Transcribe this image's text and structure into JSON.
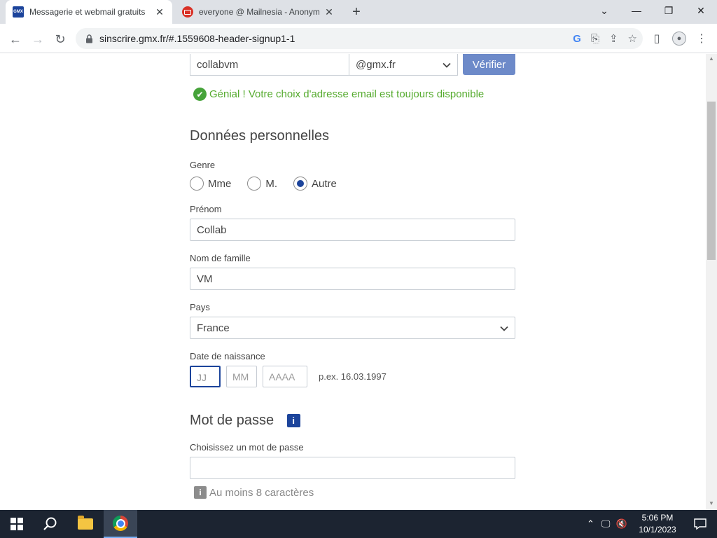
{
  "browser": {
    "tabs": [
      {
        "title": "Messagerie et webmail gratuits",
        "favicon": "GMX"
      },
      {
        "title": "everyone @ Mailnesia - Anonym"
      }
    ],
    "url": "sinscrire.gmx.fr/#.1559608-header-signup1-1"
  },
  "form": {
    "email_local": "collabvm",
    "email_domain": "@gmx.fr",
    "verify_label": "Vérifier",
    "availability_message": "Génial ! Votre choix d'adresse email est toujours disponible",
    "personal_section": "Données personnelles",
    "gender_label": "Genre",
    "gender_options": [
      "Mme",
      "M.",
      "Autre"
    ],
    "gender_selected": "Autre",
    "first_name_label": "Prénom",
    "first_name_value": "Collab",
    "last_name_label": "Nom de famille",
    "last_name_value": "VM",
    "country_label": "Pays",
    "country_value": "France",
    "dob_label": "Date de naissance",
    "dob_day_placeholder": "JJ",
    "dob_month_placeholder": "MM",
    "dob_year_placeholder": "AAAA",
    "dob_example": "p.ex. 16.03.1997",
    "password_section": "Mot de passe",
    "password_info": "i",
    "password_label": "Choisissez un mot de passe",
    "password_hint": "Au moins 8 caractères"
  },
  "taskbar": {
    "time": "5:06 PM",
    "date": "10/1/2023"
  },
  "colors": {
    "brand_blue": "#1c449b",
    "verify_button": "#6d8ac9",
    "success_green": "#56ab2f"
  }
}
